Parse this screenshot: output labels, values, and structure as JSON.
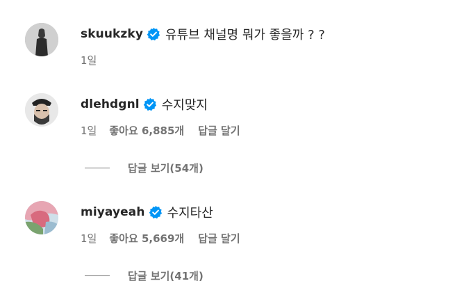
{
  "comments": [
    {
      "username": "skuukzky",
      "text": "유튜브 채널명 뭐가 좋을까 ? ?",
      "time": "1일",
      "likes": "",
      "reply_label": ""
    },
    {
      "username": "dlehdgnl",
      "text": "수지맞지",
      "time": "1일",
      "likes": "좋아요 6,885개",
      "reply_label": "답글 달기",
      "view_replies": "답글 보기(54개)"
    },
    {
      "username": "miyayeah",
      "text": "수지타산",
      "time": "1일",
      "likes": "좋아요 5,669개",
      "reply_label": "답글 달기",
      "view_replies": "답글 보기(41개)"
    }
  ],
  "colors": {
    "verified_badge": "#0095f6",
    "primary_text": "#262626",
    "secondary_text": "#737373"
  },
  "icons": {
    "verified": "verified-badge-icon"
  }
}
